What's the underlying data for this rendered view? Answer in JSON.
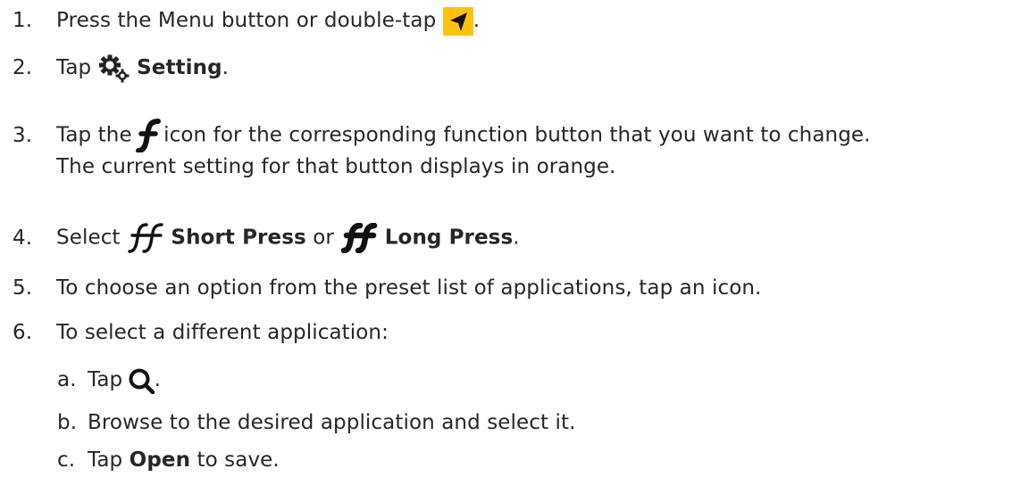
{
  "steps": [
    {
      "number": "1.",
      "text": "Press the Menu button or double-tap",
      "suffix": "."
    },
    {
      "number": "2.",
      "prefix": "Tap",
      "bold": "Setting",
      "suffix": "."
    },
    {
      "number": "3.",
      "prefix": "Tap the",
      "text": "icon for the corresponding function button that you want to change.",
      "line2": "The current setting for that button displays in orange."
    },
    {
      "number": "4.",
      "prefix": "Select",
      "bold1": "Short Press",
      "mid": "or",
      "bold2": "Long Press",
      "suffix": "."
    },
    {
      "number": "5.",
      "text": "To choose an option from the preset list of applications, tap an icon."
    },
    {
      "number": "6.",
      "text": "To select a different application:"
    }
  ],
  "substeps": [
    {
      "letter": "a.",
      "prefix": "Tap",
      "suffix": "."
    },
    {
      "letter": "b.",
      "text": "Browse to the desired application and select it."
    },
    {
      "letter": "c.",
      "prefix": "Tap",
      "bold": "Open",
      "suffix": "to save."
    }
  ],
  "icons": {
    "navigate": "navigate-arrow-icon",
    "settings": "gears-icon",
    "function": "function-f-icon",
    "short_press": "double-f-outline-icon",
    "long_press": "double-f-bold-icon",
    "search": "magnifier-icon"
  },
  "colors": {
    "text": "#262626",
    "nav_icon_bg": "#ffc20e"
  }
}
